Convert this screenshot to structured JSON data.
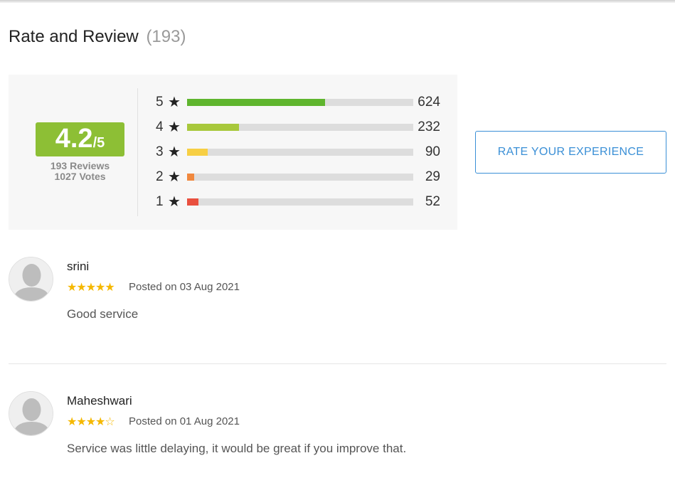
{
  "header": {
    "title": "Rate and Review",
    "count": "(193)"
  },
  "summary": {
    "score": "4.2",
    "score_suffix": "/5",
    "reviews_text": "193 Reviews",
    "votes_text": "1027 Votes",
    "badge_color": "#8dbf35"
  },
  "distribution": [
    {
      "stars": "5",
      "count": "624",
      "fraction": 0.61,
      "color": "#5fb52e"
    },
    {
      "stars": "4",
      "count": "232",
      "fraction": 0.23,
      "color": "#a8c83c"
    },
    {
      "stars": "3",
      "count": "90",
      "fraction": 0.09,
      "color": "#f7cf44"
    },
    {
      "stars": "2",
      "count": "29",
      "fraction": 0.03,
      "color": "#f0883e"
    },
    {
      "stars": "1",
      "count": "52",
      "fraction": 0.05,
      "color": "#e9503f"
    }
  ],
  "rate_button": {
    "label": "RATE YOUR EXPERIENCE",
    "color": "#3a8fd6"
  },
  "reviews": [
    {
      "name": "srini",
      "rating": 5,
      "posted": "Posted on 03 Aug 2021",
      "text": "Good service"
    },
    {
      "name": "Maheshwari",
      "rating": 4,
      "posted": "Posted on 01 Aug 2021",
      "text": "Service was little delaying, it would be great if you improve that."
    }
  ]
}
